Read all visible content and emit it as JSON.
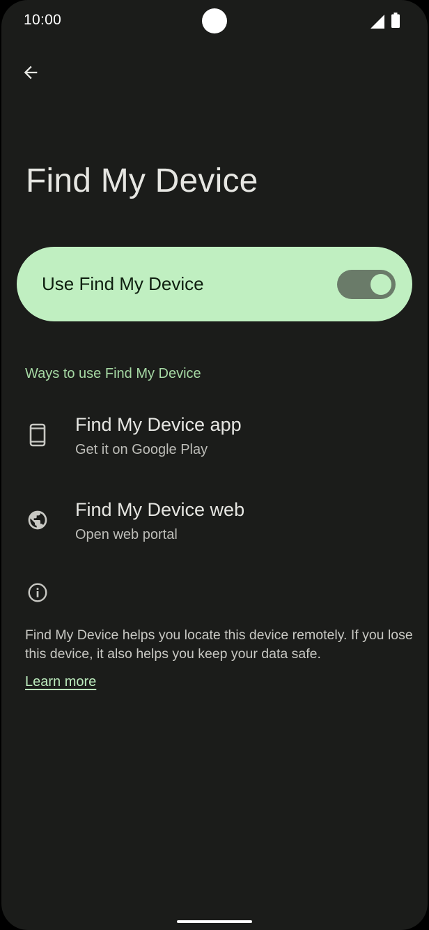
{
  "status_bar": {
    "time": "10:00",
    "signal_icon": "cellular-signal-icon",
    "battery_icon": "battery-icon"
  },
  "app_bar": {
    "back_icon": "arrow-back-icon"
  },
  "page": {
    "title": "Find My Device"
  },
  "main_switch": {
    "label": "Use Find My Device",
    "checked": true,
    "colors": {
      "card": "#c0efc1",
      "track": "#6a7b69",
      "thumb": "#c0efc1"
    }
  },
  "section": {
    "header": "Ways to use Find My Device",
    "items": [
      {
        "icon": "smartphone-icon",
        "title": "Find My Device app",
        "summary": "Get it on Google Play"
      },
      {
        "icon": "globe-icon",
        "title": "Find My Device web",
        "summary": "Open web portal"
      }
    ]
  },
  "footer": {
    "icon": "info-icon",
    "text": "Find My Device helps you locate this device remotely. If you lose this device, it also helps you keep your data safe.",
    "link": "Learn more"
  },
  "theme": {
    "background": "#1b1c1a",
    "accent": "#a6d9a4",
    "text_primary": "#e6e6e2",
    "text_secondary": "#bdbdb8"
  }
}
